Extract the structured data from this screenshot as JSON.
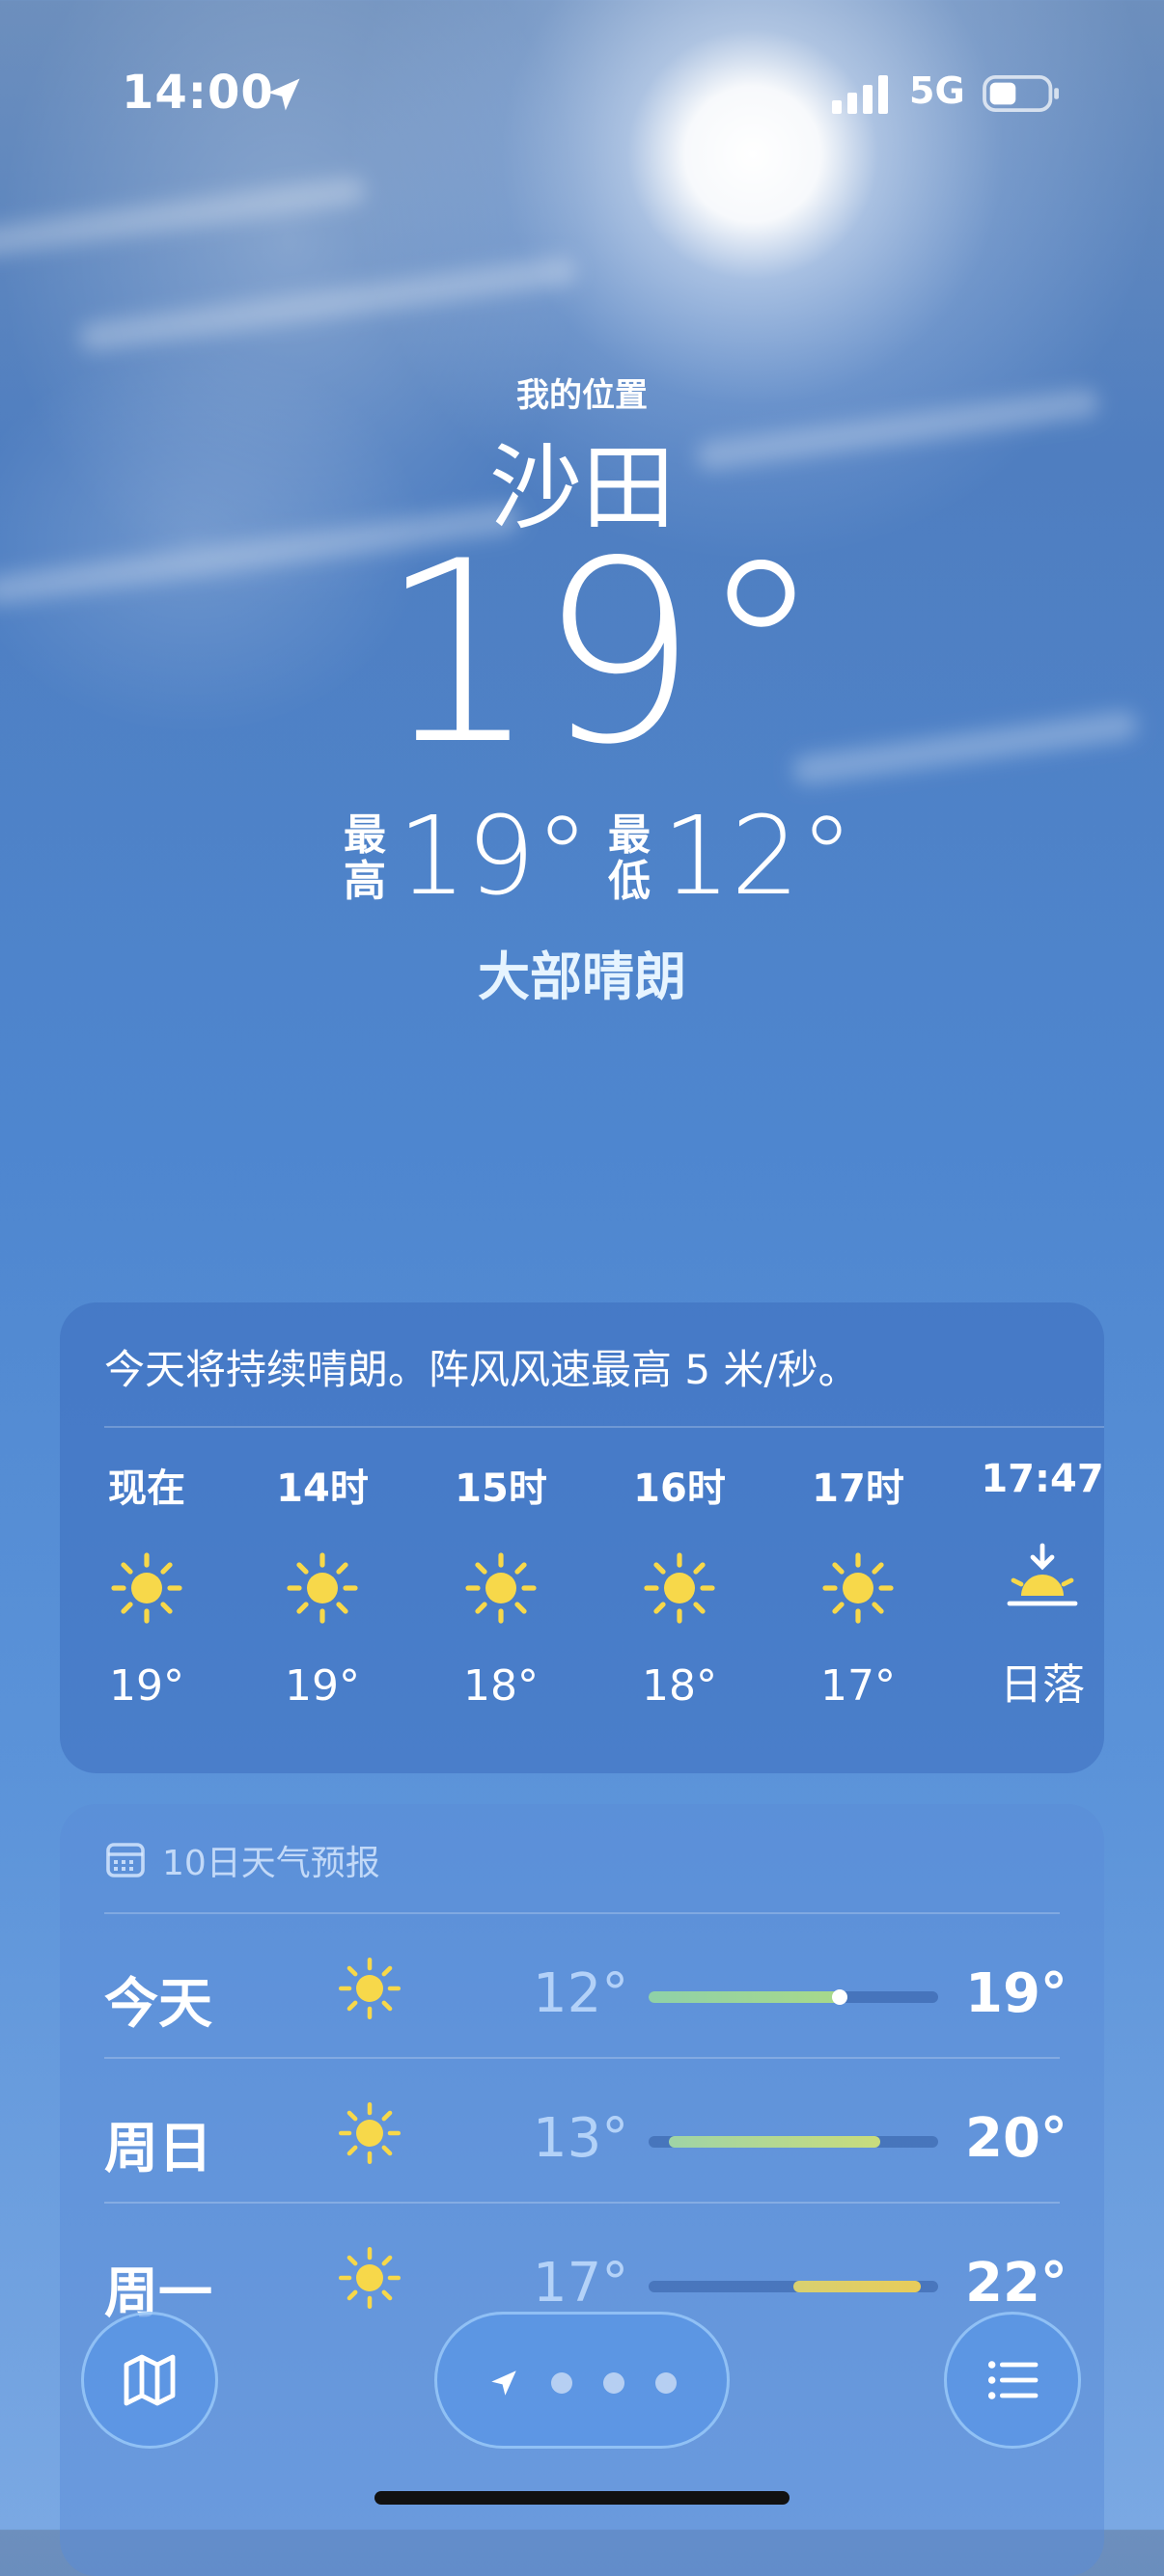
{
  "status_bar": {
    "time": "14:00",
    "network": "5G"
  },
  "header": {
    "location_label": "我的位置",
    "city": "沙田",
    "temperature": "19°",
    "high_label": "最高",
    "high": "19°",
    "low_label": "最低",
    "low": "12°",
    "condition": "大部晴朗"
  },
  "hourly": {
    "summary": "今天将持续晴朗。阵风风速最高 5 米/秒。",
    "items": [
      {
        "label": "现在",
        "icon": "sun-icon",
        "temp": "19°"
      },
      {
        "label": "14时",
        "icon": "sun-icon",
        "temp": "19°"
      },
      {
        "label": "15时",
        "icon": "sun-icon",
        "temp": "18°"
      },
      {
        "label": "16时",
        "icon": "sun-icon",
        "temp": "18°"
      },
      {
        "label": "17时",
        "icon": "sun-icon",
        "temp": "17°"
      },
      {
        "label": "17:47",
        "icon": "sunset-icon",
        "temp": "日落"
      }
    ]
  },
  "daily": {
    "title": "10日天气预报",
    "days": [
      {
        "day": "今天",
        "icon": "sun-icon",
        "low": "12°",
        "high": "19°",
        "range_start": 0.0,
        "range_end": 0.66,
        "current": 0.66,
        "color_from": "#8fd1a8",
        "color_to": "#a8d98a"
      },
      {
        "day": "周日",
        "icon": "sun-icon",
        "low": "13°",
        "high": "20°",
        "range_start": 0.07,
        "range_end": 0.8,
        "current": null,
        "color_from": "#9fd4a6",
        "color_to": "#c9dc7c"
      },
      {
        "day": "周一",
        "icon": "sun-icon",
        "low": "17°",
        "high": "22°",
        "range_start": 0.5,
        "range_end": 0.94,
        "current": null,
        "color_from": "#d8d070",
        "color_to": "#e8cc5a"
      }
    ]
  },
  "colors": {
    "sun": "#f7d84a",
    "card_hourly": "#3c6ebe",
    "accent_text": "#e6f4ff"
  }
}
